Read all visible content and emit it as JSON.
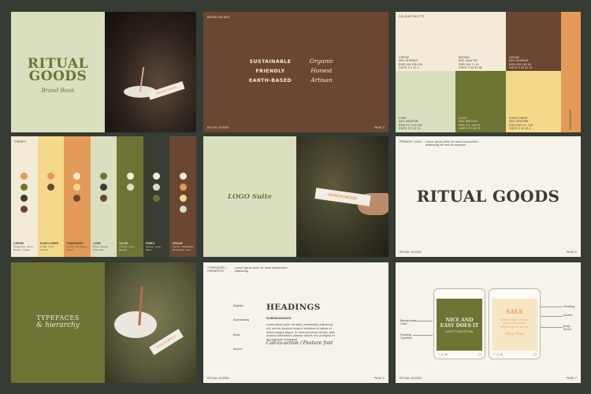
{
  "slide1": {
    "title_line1": "RITUAL",
    "title_line2": "GOODS",
    "subtitle": "Brand Book",
    "stick_label": "SANDALWOOD"
  },
  "slide2": {
    "heading": "BRAND VALUES",
    "left": [
      "SUSTAINABLE",
      "FRIENDLY",
      "EARTH-BASED"
    ],
    "right": [
      "Organic",
      "Honest",
      "Artisan"
    ],
    "footer_left": "RITUAL GOODS",
    "footer_right": "PAGE 2"
  },
  "slide3": {
    "heading": "COLOUR PALETTE",
    "swatches": [
      {
        "name": "CREME",
        "lines": [
          "HEX #F4EBD7",
          "RGB 244 235 215",
          "CMYK 0 4 12 4"
        ],
        "color": "#f4ebd7"
      },
      {
        "name": "BROWN",
        "lines": [
          "HEX #6A4733",
          "RGB 106 71 51",
          "CMYK 0 33 52 58"
        ],
        "color": "#6a4733"
      },
      {
        "name": "CEDAR",
        "lines": [
          "HEX #E49B59",
          "RGB 228 155 89",
          "CMYK 0 32 61 11"
        ],
        "color": "#e49b59"
      },
      {
        "name": "LORE",
        "lines": [
          "HEX #D9DFBF",
          "RGB 217 223 191",
          "CMYK 3 0 14 13"
        ],
        "color": "#d9dfbf"
      },
      {
        "name": "OLIVE",
        "lines": [
          "HEX #6E7433",
          "RGB 110 116 51",
          "CMYK 5 0 56 55"
        ],
        "color": "#6e7433"
      },
      {
        "name": "SUNFLOWER",
        "lines": [
          "HEX #F5D98B",
          "RGB 245 217 139",
          "CMYK 0 11 43 4"
        ],
        "color": "#f5d98b"
      }
    ],
    "side_label": "SANDALWOOD"
  },
  "slide4": {
    "heading": "THEMES",
    "columns": [
      {
        "name": "CREME",
        "desc": "Tangerine, Olive, Brown, Cedar",
        "bg": "#f4ebd7",
        "text": "#3a3d31",
        "dots": [
          "#e49b59",
          "#6e7433",
          "#3a3d31",
          "#6a4733"
        ]
      },
      {
        "name": "SUNFLOWER",
        "desc": "Cedar, Pine, Yellow",
        "bg": "#f5d98b",
        "text": "#3a3d31",
        "dots": [
          "#e49b59",
          "#6a4733"
        ]
      },
      {
        "name": "TANGERINE",
        "desc": "Creme, Sunflower, Cedar",
        "bg": "#e49b59",
        "text": "#3a3d31",
        "dots": [
          "#f4ebd7",
          "#f5d98b",
          "#6a4733"
        ]
      },
      {
        "name": "LORE",
        "desc": "Olive, Brown, Charcoal",
        "bg": "#d9dfbf",
        "text": "#3a3d31",
        "dots": [
          "#6e7433",
          "#3a3d31",
          "#6a4733"
        ]
      },
      {
        "name": "OLIVE",
        "desc": "Creme, Lore, Brown",
        "bg": "#6e7433",
        "text": "#f4ebd7",
        "dots": [
          "#f4ebd7",
          "#d9dfbf"
        ]
      },
      {
        "name": "PINES",
        "desc": "Creme, Lore, Olive",
        "bg": "#3a3d31",
        "text": "#f4ebd7",
        "dots": [
          "#f4ebd7",
          "#d9dfbf",
          "#6e7433"
        ]
      },
      {
        "name": "CEDAR",
        "desc": "Creme, Sunflower, Tangerine, Lore",
        "bg": "#6a4733",
        "text": "#f4ebd7",
        "dots": [
          "#f4ebd7",
          "#e49b59",
          "#f5d98b",
          "#d9dfbf"
        ]
      }
    ]
  },
  "slide5": {
    "title": "LOGO Suite",
    "stick_label": "SANDALWOOD"
  },
  "slide6": {
    "heading": "PRIMARY LOGO",
    "note": "Lorem ipsum dolor sit amet consectetur adipiscing elit sed do eiusmod",
    "logo": "RITUAL GOODS",
    "footer_left": "RITUAL GOODS",
    "footer_right": "PAGE 5"
  },
  "slide7": {
    "title_line1": "TYPEFACES",
    "title_line2": "& hierarchy",
    "stick_label": "SANDALWOOD"
  },
  "slide8": {
    "heading": "TYPEFACES + HIERARCHY",
    "note": "Lorem ipsum dolor sit amet consectetur adipiscing",
    "labels": [
      "Display",
      "Subheading",
      "Body",
      "Accent"
    ],
    "headings": "HEADINGS",
    "subheadings": "SUBHEADINGS",
    "body": "Lorem ipsum dolor sit amet, consectetur adipiscing elit, sed do eiusmod tempor incididunt ut labore et dolore magna aliqua. Ut enim ad minim veniam, quis nostrud exercitation ullamco laboris nisi ut aliquip ex ea commodo consequat.",
    "accent": "Call-to-action / Feature font",
    "footer_left": "RITUAL GOODS",
    "footer_right": "PAGE 6"
  },
  "slide9": {
    "phone1_title_line1": "NICE AND",
    "phone1_title_line2": "EASY DOES IT",
    "phone1_sub": "LIGHT YOUR RITUAL",
    "phone2_title": "SALE",
    "phone2_body": "Lorem ipsum dolor sit amet consectetur adipiscing elit sed do",
    "phone2_script": "Shop Now",
    "left_notes": [
      "Background",
      "Olive",
      "Heading",
      "Typeface"
    ],
    "right_notes": [
      "Heading",
      "Accent",
      "Body",
      "Script"
    ],
    "footer_left": "RITUAL GOODS",
    "footer_right": "PAGE 7"
  }
}
